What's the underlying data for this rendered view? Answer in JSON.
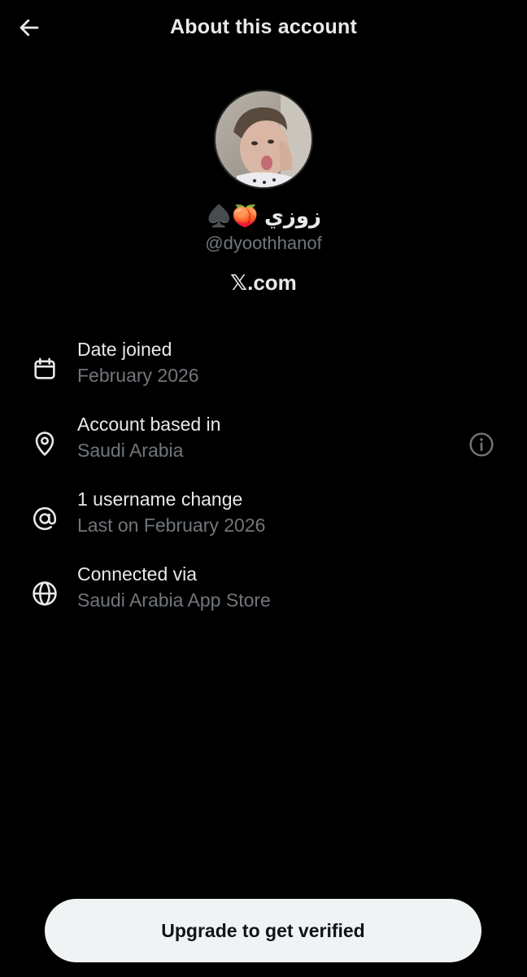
{
  "header": {
    "title": "About this account",
    "back_icon": "arrow-left-icon"
  },
  "profile": {
    "display_name": "زوزي 🍑♠️",
    "handle": "@dyoothhanof",
    "domain": "𝕏.com"
  },
  "details": [
    {
      "icon": "calendar-icon",
      "label": "Date joined",
      "value": "February 2026"
    },
    {
      "icon": "location-pin-icon",
      "label": "Account based in",
      "value": "Saudi Arabia",
      "has_info": true
    },
    {
      "icon": "at-sign-icon",
      "label": "1 username change",
      "value": "Last on February 2026"
    },
    {
      "icon": "globe-icon",
      "label": "Connected via",
      "value": "Saudi Arabia App Store"
    }
  ],
  "cta": {
    "label": "Upgrade to get verified"
  },
  "colors": {
    "background": "#000000",
    "primary_text": "#e7e9ea",
    "secondary_text": "#71767b",
    "button_bg": "#eff3f4",
    "button_text": "#0f1419"
  }
}
